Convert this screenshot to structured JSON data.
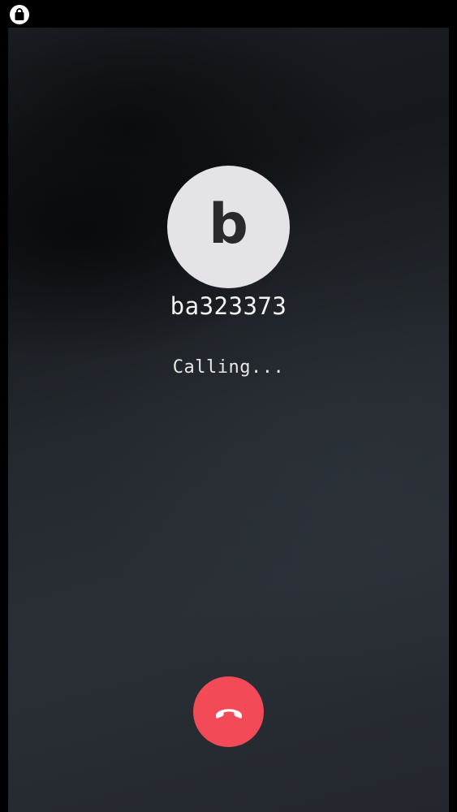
{
  "status_bar": {
    "icon": "shopping-bag-icon"
  },
  "contact": {
    "avatar_letter": "b",
    "name": "ba323373"
  },
  "call": {
    "status": "Calling...",
    "end_call_icon": "phone-hangup-icon"
  },
  "colors": {
    "end_call": "#f24b57",
    "avatar_bg": "#e4e4e8",
    "background": "#1e2227"
  }
}
